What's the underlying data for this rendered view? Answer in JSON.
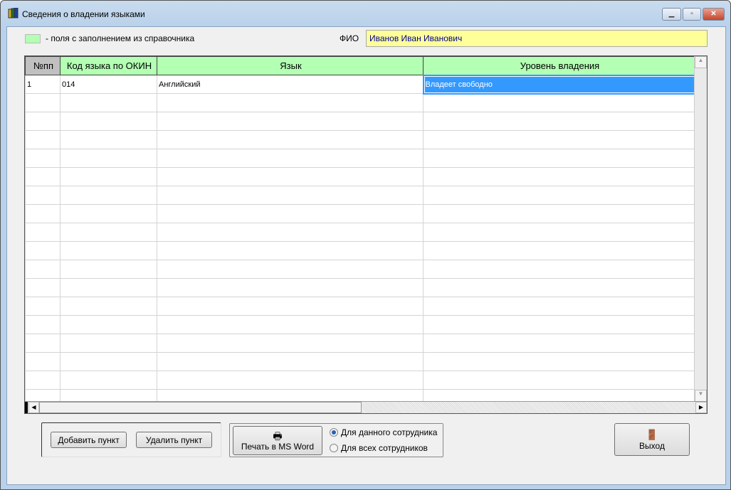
{
  "window": {
    "title": "Сведения о владении языками",
    "controls": [
      "minimize",
      "restore",
      "close"
    ]
  },
  "legend": {
    "text": "- поля с заполнением из справочника",
    "color": "#b3ffb3"
  },
  "fio": {
    "label": "ФИО",
    "value": "Иванов Иван Иванович"
  },
  "grid": {
    "columns": [
      "№пп",
      "Код языка по ОКИН",
      "Язык",
      "Уровень владения"
    ],
    "rows": [
      [
        "1",
        "014",
        "Английский",
        "Владеет свободно"
      ]
    ],
    "empty_rows": 17
  },
  "buttons": {
    "add": "Добавить пункт",
    "delete": "Удалить пункт",
    "print": "Печать в MS Word",
    "exit": "Выход"
  },
  "print_options": {
    "current": "Для данного сотрудника",
    "all": "Для всех сотрудников",
    "selected": "current"
  }
}
